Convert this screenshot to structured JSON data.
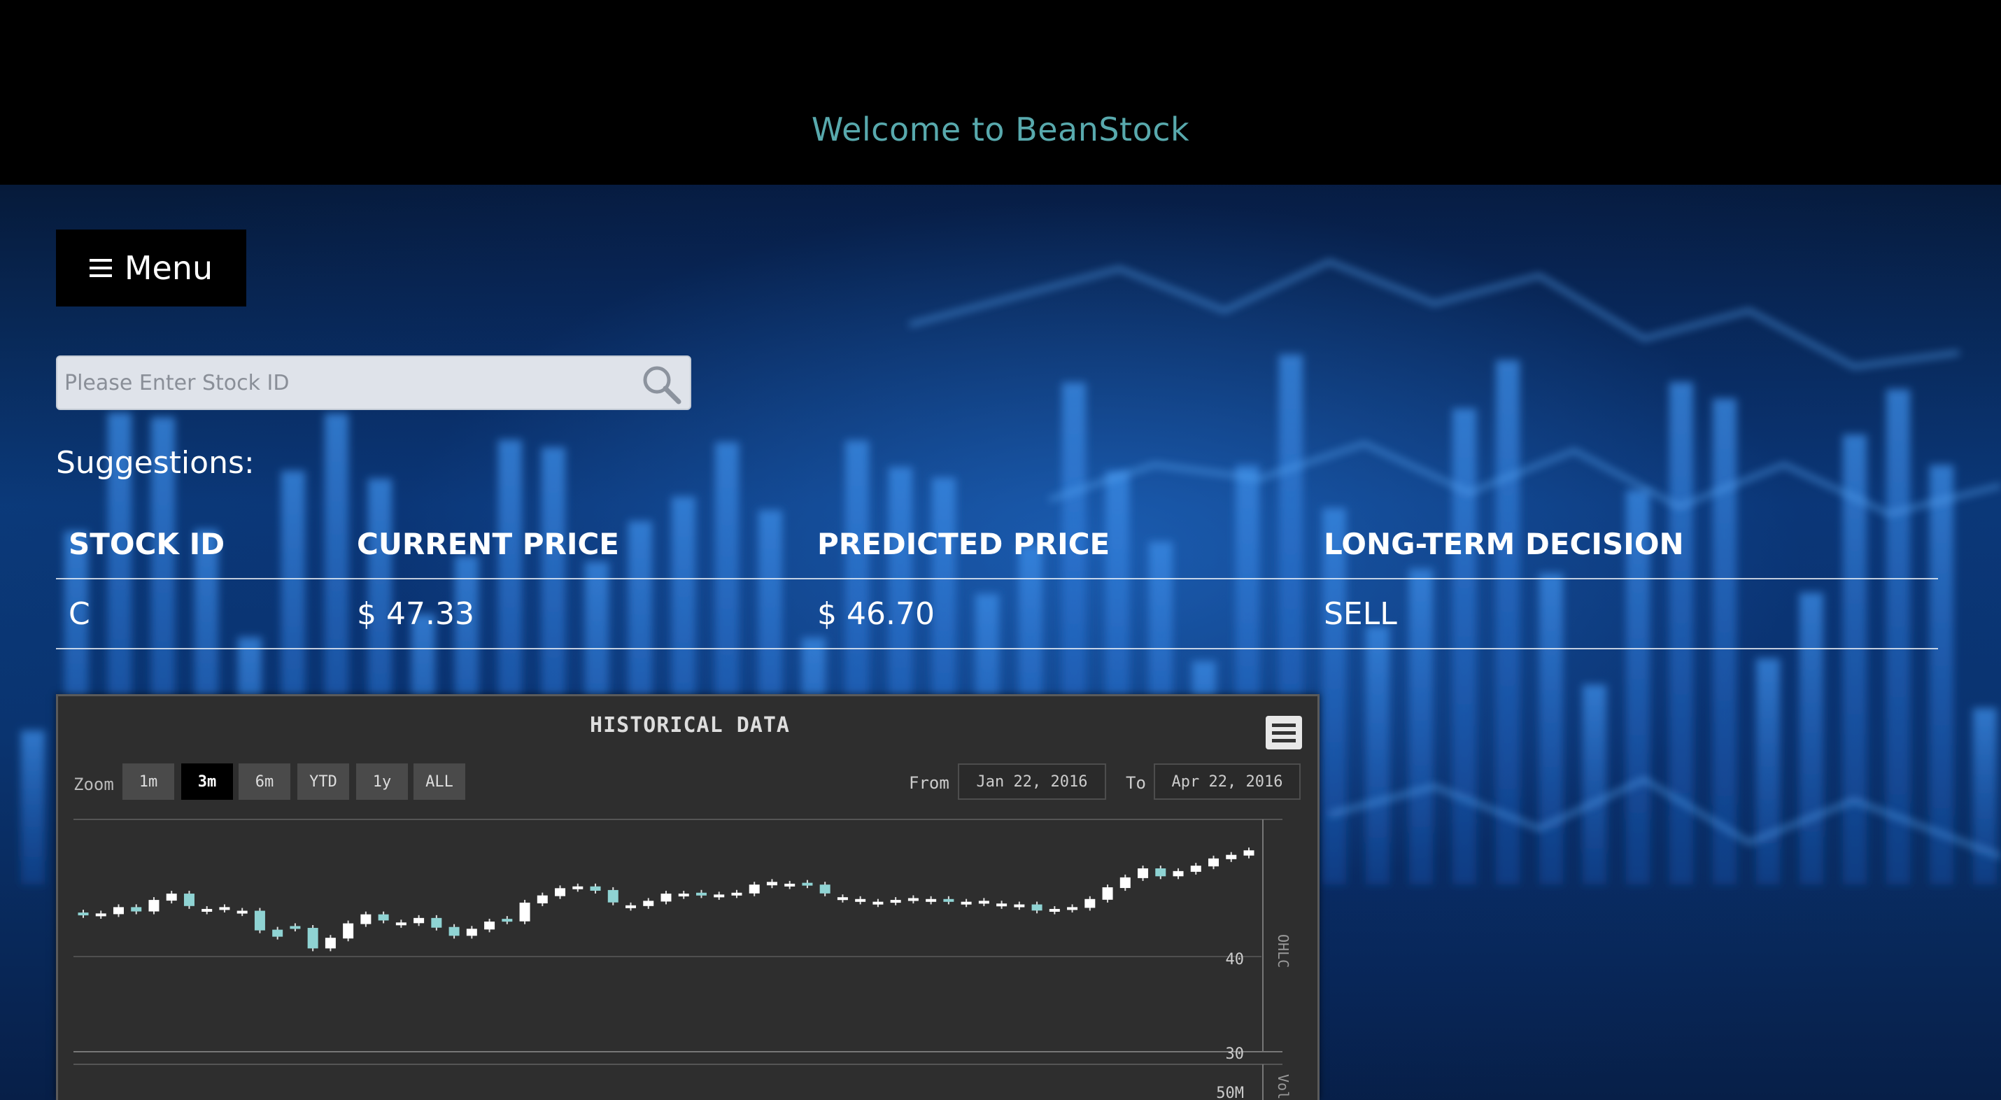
{
  "header": {
    "welcome": "Welcome to BeanStock"
  },
  "menu": {
    "label": "Menu"
  },
  "search": {
    "placeholder": "Please Enter Stock ID"
  },
  "suggestions_label": "Suggestions:",
  "table": {
    "columns": [
      "STOCK ID",
      "CURRENT PRICE",
      "PREDICTED PRICE",
      "LONG-TERM DECISION"
    ],
    "rows": [
      {
        "stock_id": "C",
        "current_price": "$ 47.33",
        "predicted_price": "$ 46.70",
        "decision": "SELL"
      }
    ]
  },
  "chart": {
    "title": "HISTORICAL DATA",
    "zoom_label": "Zoom",
    "zoom_buttons": [
      "1m",
      "3m",
      "6m",
      "YTD",
      "1y",
      "ALL"
    ],
    "active_zoom": "3m",
    "from_label": "From",
    "from_date": "Jan 22, 2016",
    "to_label": "To",
    "to_date": "Apr 22, 2016",
    "ohlc_axis_label": "OHLC",
    "volume_axis_label": "Volu",
    "ohlc_ticks": [
      "40",
      "30"
    ],
    "volume_ticks": [
      "50M"
    ]
  },
  "chart_data": {
    "type": "candlestick",
    "title": "HISTORICAL DATA",
    "x_range": [
      "Jan 22, 2016",
      "Apr 22, 2016"
    ],
    "ylabel": "OHLC",
    "ylim": [
      25,
      50
    ],
    "closes": [
      40.2,
      40.3,
      41.0,
      40.6,
      41.8,
      42.5,
      41.2,
      40.8,
      41.0,
      40.6,
      38.5,
      37.8,
      38.7,
      36.5,
      37.6,
      39.2,
      40.2,
      39.6,
      39.3,
      39.8,
      38.8,
      37.9,
      38.6,
      39.4,
      39.5,
      41.5,
      42.3,
      43.1,
      43.3,
      42.9,
      41.6,
      41.2,
      41.7,
      42.5,
      42.5,
      42.4,
      42.4,
      42.6,
      43.5,
      43.8,
      43.6,
      43.5,
      42.6,
      42.1,
      41.9,
      41.6,
      41.8,
      42.0,
      41.9,
      41.7,
      41.6,
      41.7,
      41.4,
      41.3,
      40.7,
      40.8,
      41.0,
      41.9,
      43.2,
      44.3,
      45.3,
      44.5,
      45.0,
      45.6,
      46.4,
      46.8,
      47.3
    ],
    "up": [
      false,
      true,
      true,
      false,
      true,
      true,
      false,
      true,
      true,
      true,
      false,
      false,
      false,
      false,
      true,
      true,
      true,
      false,
      true,
      true,
      false,
      false,
      true,
      true,
      false,
      true,
      true,
      true,
      true,
      false,
      false,
      true,
      true,
      true,
      true,
      false,
      true,
      true,
      true,
      true,
      true,
      false,
      false,
      true,
      true,
      true,
      true,
      true,
      true,
      false,
      true,
      true,
      true,
      true,
      false,
      true,
      true,
      true,
      true,
      true,
      true,
      false,
      true,
      true,
      true,
      true,
      true
    ]
  }
}
